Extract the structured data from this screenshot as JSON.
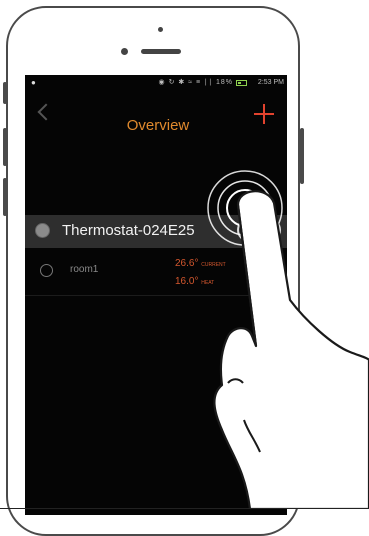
{
  "status_bar": {
    "battery_percent": "18%",
    "time": "2:53 PM",
    "icons": "◉ ↻ ✱ ≈ ≡ ∣∣"
  },
  "navbar": {
    "title": "Overview",
    "back_icon": "chevron-left-icon",
    "add_icon": "plus-icon",
    "accent_color": "#e08a2e",
    "add_color": "#e2432e"
  },
  "device": {
    "name": "Thermostat-024E25",
    "toggle_on": false,
    "icon": "thermostat-icon"
  },
  "room": {
    "name": "room1",
    "current_temp": "26.6°",
    "current_label": "CURRENT",
    "heat_temp": "16.0°",
    "heat_label": "HEAT"
  },
  "gesture": {
    "type": "tap",
    "target": "device-toggle"
  }
}
